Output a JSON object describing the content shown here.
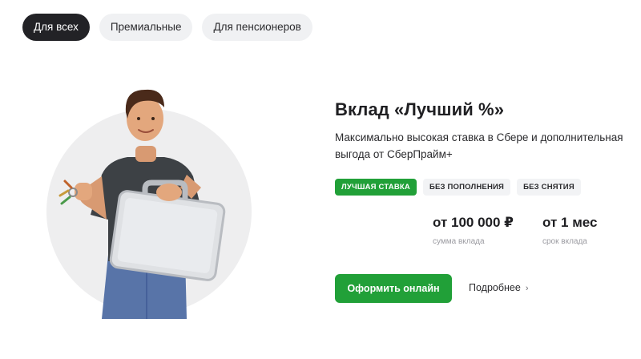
{
  "tabs": [
    {
      "label": "Для всех",
      "active": true
    },
    {
      "label": "Премиальные",
      "active": false
    },
    {
      "label": "Для пенсионеров",
      "active": false
    }
  ],
  "product": {
    "title": "Вклад «Лучший %»",
    "description": "Максимально высокая ставка в Сбере и дополнительная выгода от СберПрайм+",
    "badges": [
      {
        "label": "ЛУЧШАЯ СТАВКА",
        "style": "green"
      },
      {
        "label": "БЕЗ ПОПОЛНЕНИЯ",
        "style": "gray"
      },
      {
        "label": "БЕЗ СНЯТИЯ",
        "style": "gray"
      }
    ],
    "stats": [
      {
        "value": "от 100 000 ₽",
        "caption": "сумма вклада"
      },
      {
        "value": "от 1 мес",
        "caption": "срок вклада"
      }
    ],
    "cta_label": "Оформить онлайн",
    "more_label": "Подробнее",
    "more_icon": "chevron-right-icon"
  },
  "colors": {
    "brand_green": "#21a038",
    "active_tab": "#222226",
    "chip_bg": "#f0f1f3"
  }
}
